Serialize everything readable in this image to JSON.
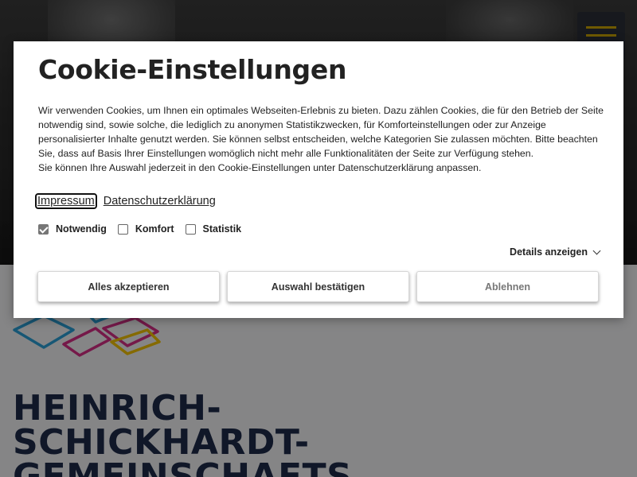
{
  "background": {
    "school_name": "HEINRICH-\nSCHICKHARDT-\nGEMEINSCHAFTS",
    "logo_colors": [
      "#2a9fd6",
      "#d62f86",
      "#f2c200"
    ]
  },
  "cookie_dialog": {
    "title": "Cookie-Einstellungen",
    "paragraph1": "Wir verwenden Cookies, um Ihnen ein optimales Webseiten-Erlebnis zu bieten. Dazu zählen Cookies, die für den Betrieb der Seite notwendig sind, sowie solche, die lediglich zu anonymen Statistikzwecken, für Komforteinstellungen oder zur Anzeige personalisierter Inhalte genutzt werden. Sie können selbst entscheiden, welche Kategorien Sie zulassen möchten. Bitte beachten Sie, dass auf Basis Ihrer Einstellungen womöglich nicht mehr alle Funktionalitäten der Seite zur Verfügung stehen.",
    "paragraph2": "Sie können Ihre Auswahl jederzeit in den Cookie-Einstellungen unter Datenschutzerklärung anpassen.",
    "links": {
      "impressum": "Impressum",
      "datenschutz": "Datenschutzerklärung"
    },
    "checkboxes": [
      {
        "label": "Notwendig",
        "checked": true
      },
      {
        "label": "Komfort",
        "checked": false
      },
      {
        "label": "Statistik",
        "checked": false
      }
    ],
    "details_label": "Details anzeigen",
    "buttons": {
      "accept_all": "Alles akzeptieren",
      "confirm": "Auswahl bestätigen",
      "reject": "Ablehnen"
    }
  }
}
